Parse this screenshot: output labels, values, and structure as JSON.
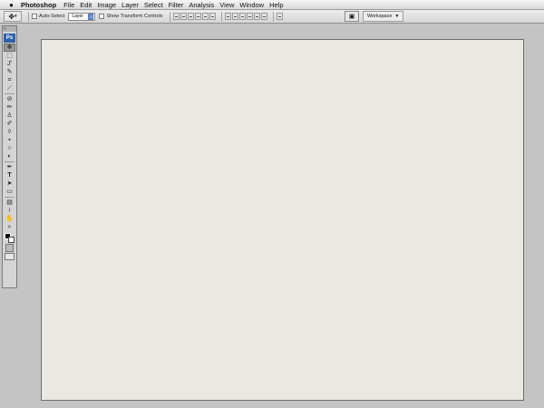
{
  "menubar": {
    "apple_icon": "apple-icon",
    "app_name": "Photoshop",
    "items": [
      "File",
      "Edit",
      "Image",
      "Layer",
      "Select",
      "Filter",
      "Analysis",
      "View",
      "Window",
      "Help"
    ]
  },
  "options_bar": {
    "tool_icon": "move-tool-icon",
    "auto_select_label": "Auto-Select",
    "auto_select_checked": false,
    "target_value": "Layer",
    "show_transform_label": "Show Transform Controls",
    "show_transform_checked": false,
    "workspace_label": "Workspace"
  },
  "tools_panel": {
    "collapse_glyph": "»",
    "logo": "Ps",
    "tools": [
      "move",
      "marquee",
      "lasso",
      "quick-select",
      "crop",
      "slice",
      "healing",
      "brush",
      "clone-stamp",
      "history-brush",
      "eraser",
      "gradient",
      "blur",
      "dodge",
      "pen",
      "type",
      "path-select",
      "shape",
      "notes",
      "eyedropper",
      "hand",
      "zoom"
    ]
  },
  "canvas": {
    "background_color": "#e9e8e3"
  },
  "colors": {
    "workspace_bg": "#c4c4c4",
    "ps_logo": "#2d61a8",
    "foreground": "#000000",
    "background": "#ffffff"
  }
}
